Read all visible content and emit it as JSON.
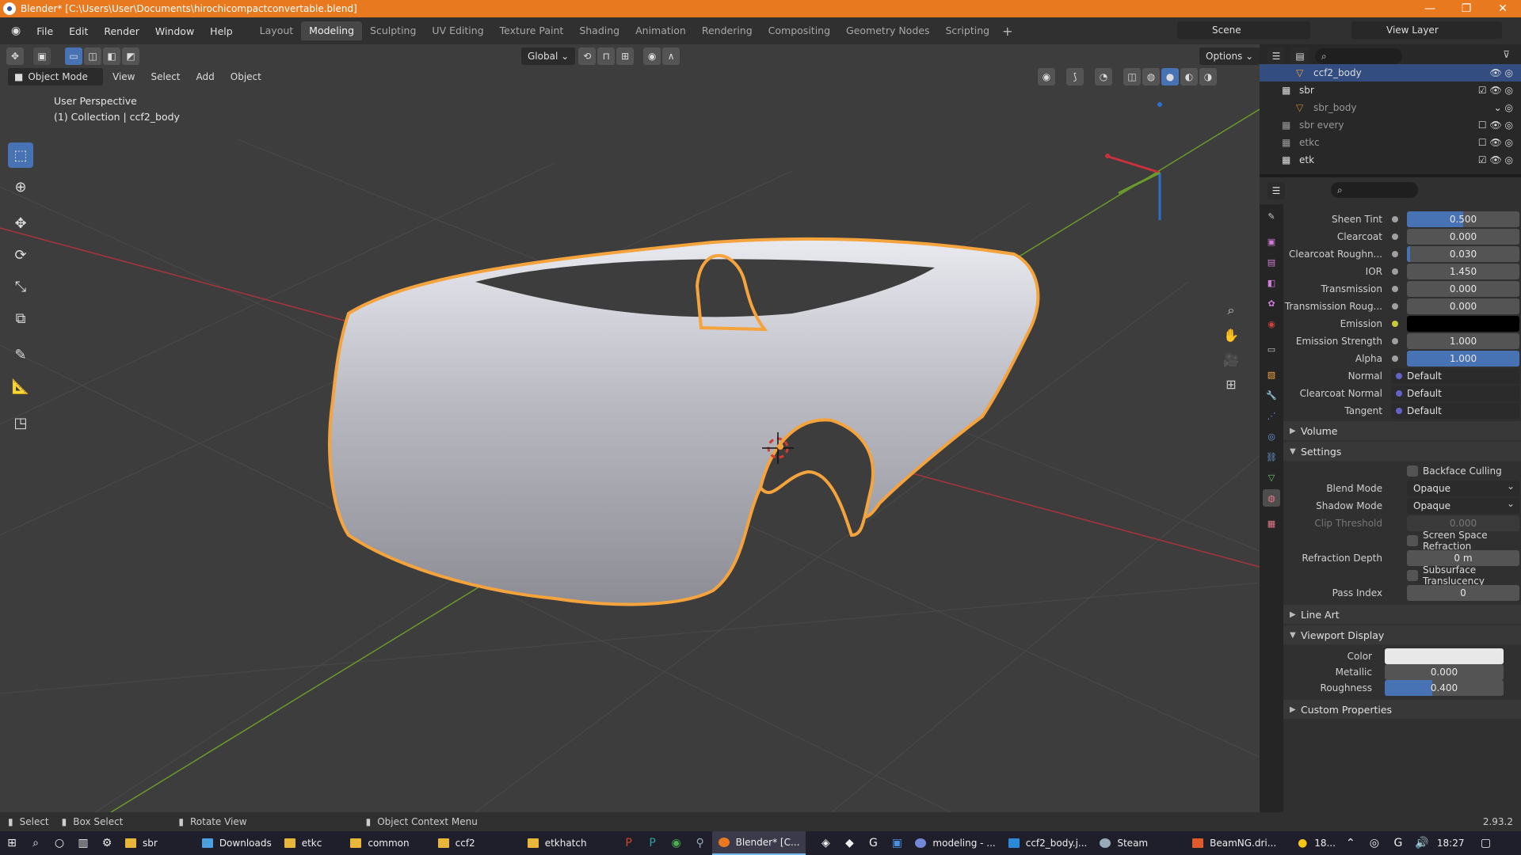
{
  "title": "Blender* [C:\\Users\\User\\Documents\\hirochicompactconvertable.blend]",
  "window_controls": [
    "—",
    "❐",
    "✕"
  ],
  "menu": [
    "File",
    "Edit",
    "Render",
    "Window",
    "Help"
  ],
  "workspaces": [
    "Layout",
    "Modeling",
    "Sculpting",
    "UV Editing",
    "Texture Paint",
    "Shading",
    "Animation",
    "Rendering",
    "Compositing",
    "Geometry Nodes",
    "Scripting"
  ],
  "active_workspace": "Modeling",
  "scene": "Scene",
  "view_layer": "View Layer",
  "viewport": {
    "mode": "Object Mode",
    "menus": [
      "View",
      "Select",
      "Add",
      "Object"
    ],
    "orientation": "Global",
    "options": "Options",
    "perspective": "User Perspective",
    "collection": "(1) Collection | ccf2_body"
  },
  "outliner": [
    {
      "name": "ccf2_body",
      "indent": 2,
      "selected": true
    },
    {
      "name": "sbr",
      "indent": 1
    },
    {
      "name": "sbr_body",
      "indent": 2
    },
    {
      "name": "sbr every",
      "indent": 1
    },
    {
      "name": "etkc",
      "indent": 1
    },
    {
      "name": "etk",
      "indent": 1
    }
  ],
  "properties": {
    "fields": [
      {
        "label": "Sheen Tint",
        "value": "0.500",
        "fill": 0.5
      },
      {
        "label": "Clearcoat",
        "value": "0.000",
        "fill": 0
      },
      {
        "label": "Clearcoat Roughn...",
        "value": "0.030",
        "fill": 0.03
      },
      {
        "label": "IOR",
        "value": "1.450",
        "fill": 0
      },
      {
        "label": "Transmission",
        "value": "0.000",
        "fill": 0
      },
      {
        "label": "Transmission Roug...",
        "value": "0.000",
        "fill": 0
      },
      {
        "label": "Emission",
        "value": "",
        "color": "#000000"
      },
      {
        "label": "Emission Strength",
        "value": "1.000",
        "fill": 0
      },
      {
        "label": "Alpha",
        "value": "1.000",
        "fill": 1
      },
      {
        "label": "Normal",
        "value": "Default",
        "link": true
      },
      {
        "label": "Clearcoat Normal",
        "value": "Default",
        "link": true
      },
      {
        "label": "Tangent",
        "value": "Default",
        "link": true
      }
    ],
    "sections": {
      "volume": "Volume",
      "settings": "Settings",
      "line_art": "Line Art",
      "viewport_display": "Viewport Display",
      "custom_properties": "Custom Properties"
    },
    "settings": {
      "backface_culling": "Backface Culling",
      "blend_mode_label": "Blend Mode",
      "blend_mode": "Opaque",
      "shadow_mode_label": "Shadow Mode",
      "shadow_mode": "Opaque",
      "clip_threshold_label": "Clip Threshold",
      "clip_threshold": "0.000",
      "ssr": "Screen Space Refraction",
      "refraction_depth_label": "Refraction Depth",
      "refraction_depth": "0 m",
      "sss": "Subsurface Translucency",
      "pass_index_label": "Pass Index",
      "pass_index": "0"
    },
    "viewport_display": {
      "color_label": "Color",
      "color": "#e8e8e8",
      "metallic_label": "Metallic",
      "metallic": "0.000",
      "roughness_label": "Roughness",
      "roughness": "0.400",
      "roughness_fill": 0.4
    }
  },
  "status": {
    "select": "Select",
    "box_select": "Box Select",
    "rotate_view": "Rotate View",
    "context_menu": "Object Context Menu",
    "version": "2.93.2"
  },
  "taskbar": {
    "items": [
      "sbr",
      "Downloads",
      "etkc",
      "common",
      "ccf2",
      "etkhatch",
      "Blender* [C...",
      "modeling - ...",
      "ccf2_body.j...",
      "Steam",
      "BeamNG.dri..."
    ],
    "active": "Blender* [C...",
    "temp": "18...",
    "time": "18:27"
  },
  "colors": {
    "accent": "#4772b3",
    "selection_outline": "#f5a33c",
    "title_bar": "#e8791f",
    "axis_x": "#c8323c",
    "axis_y": "#6a9a2b",
    "axis_z": "#2c6fd0"
  }
}
